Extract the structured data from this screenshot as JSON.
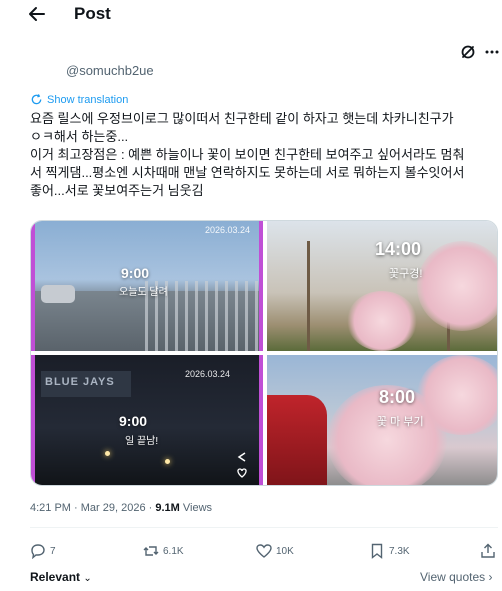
{
  "header": {
    "title": "Post",
    "back_icon": "arrow-left-icon"
  },
  "author": {
    "handle": "@somuchb2ue"
  },
  "post": {
    "translate_label": "Show translation",
    "text_lines": [
      "요즘 릴스에 우정브이로그 많이떠서 친구한테 같이 하자고 햇는데 차카니친구가",
      "ㅇㅋ해서 하는중...",
      "이거 최고장점은 : 예쁜 하늘이나 꽃이 보이면 친구한테 보여주고 싶어서라도 멈춰",
      "서 찍게댐...평소엔 시차때매 맨날 연락하지도 못하는데 서로 뭐하는지 볼수잇어서",
      "좋어...서로 꽃보여주는거 님웃김"
    ]
  },
  "media": {
    "tiles": [
      {
        "date": "2026.03.24",
        "time": "9:00",
        "caption": "오늘도 달려"
      },
      {
        "date": "2026.03.24",
        "time": "9:00",
        "caption": "일 끝남!",
        "sign_text": "BLUE JAYS"
      },
      {
        "date": "",
        "time": "14:00",
        "caption": "꽃구경!"
      },
      {
        "date": "",
        "time": "8:00",
        "caption": "꽃 마 부기"
      }
    ]
  },
  "meta": {
    "timestamp": "4:21 PM · Mar 29, 2026 · ",
    "views_count": "9.1M",
    "views_label": " Views"
  },
  "actions": {
    "replies": "7",
    "reposts": "6.1K",
    "likes": "10K",
    "bookmarks": "7.3K"
  },
  "footer": {
    "sort_label": "Relevant",
    "view_quotes": "View quotes"
  },
  "colors": {
    "accent": "#1d9bf0",
    "text": "#0f1419",
    "secondary": "#536471",
    "frame": "#c04fd6"
  }
}
